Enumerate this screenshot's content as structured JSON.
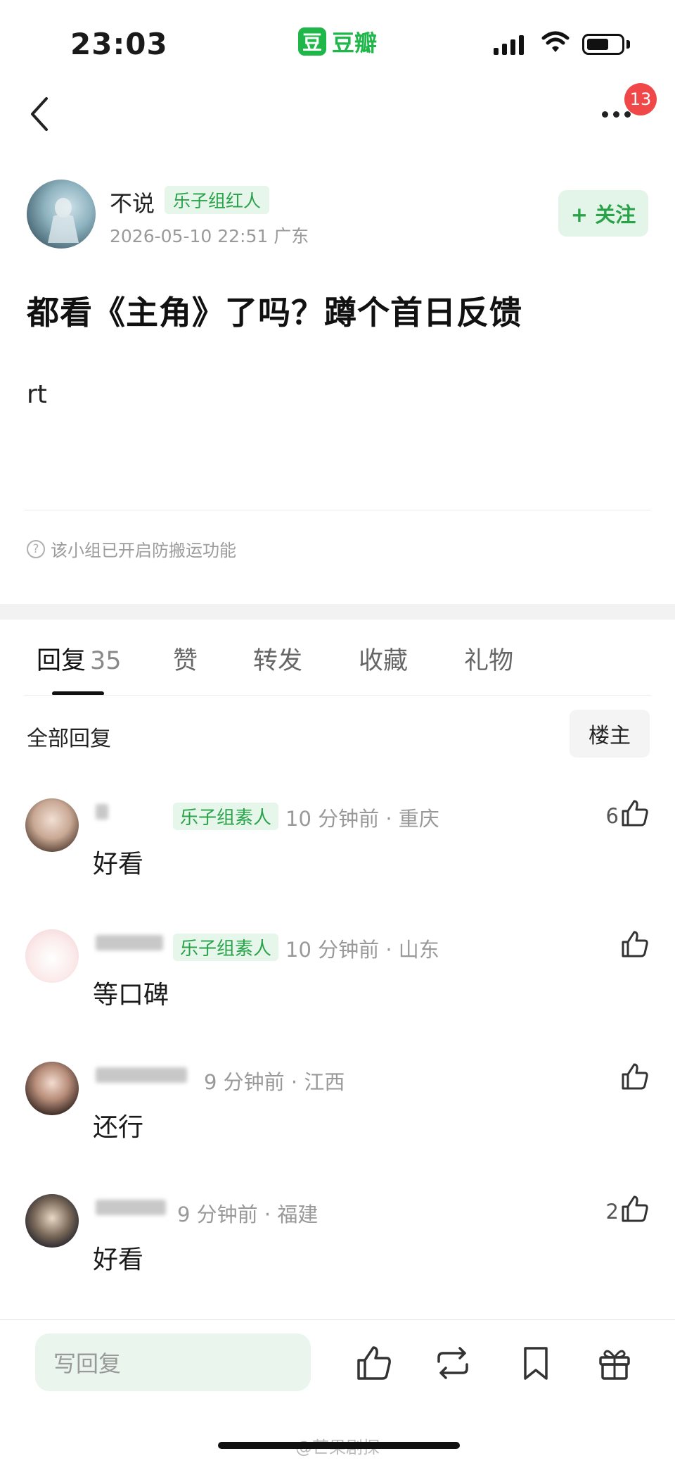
{
  "status_bar": {
    "time": "23:03",
    "app_logo_char": "豆",
    "app_name": "豆瓣"
  },
  "nav": {
    "notification_count": "13"
  },
  "post": {
    "author": {
      "name": "不说",
      "tag": "乐子组红人"
    },
    "meta": "2026-05-10 22:51 广东",
    "follow_label": "+ 关注",
    "title": "都看《主角》了吗？蹲个首日反馈",
    "body": "rt",
    "notice": "该小组已开启防搬运功能",
    "notice_icon_char": "?"
  },
  "tabs": {
    "replies_label": "回复",
    "replies_count": "35",
    "likes_label": "赞",
    "reposts_label": "转发",
    "favorites_label": "收藏",
    "gifts_label": "礼物"
  },
  "replies_header": {
    "all_label": "全部回复",
    "op_filter_label": "楼主"
  },
  "comments": [
    {
      "tag": "乐子组素人",
      "meta": "10 分钟前 · 重庆",
      "text": "好看",
      "likes": "6"
    },
    {
      "tag": "乐子组素人",
      "meta": "10 分钟前 · 山东",
      "text": "等口碑",
      "likes": ""
    },
    {
      "tag": "",
      "meta": "9 分钟前 · 江西",
      "text": "还行",
      "likes": ""
    },
    {
      "tag": "",
      "meta": "9 分钟前 · 福建",
      "text": "好看",
      "likes": "2"
    }
  ],
  "bottom_bar": {
    "reply_placeholder": "写回复"
  },
  "watermark": "@芒果剧探",
  "colors": {
    "brand_green": "#1fb74a",
    "tag_green": "#2aa24a",
    "badge_red": "#f04848"
  },
  "icons": [
    "back-icon",
    "more-icon",
    "like-icon",
    "repost-icon",
    "bookmark-icon",
    "gift-icon",
    "question-icon",
    "wifi-icon",
    "signal-icon",
    "battery-icon"
  ]
}
